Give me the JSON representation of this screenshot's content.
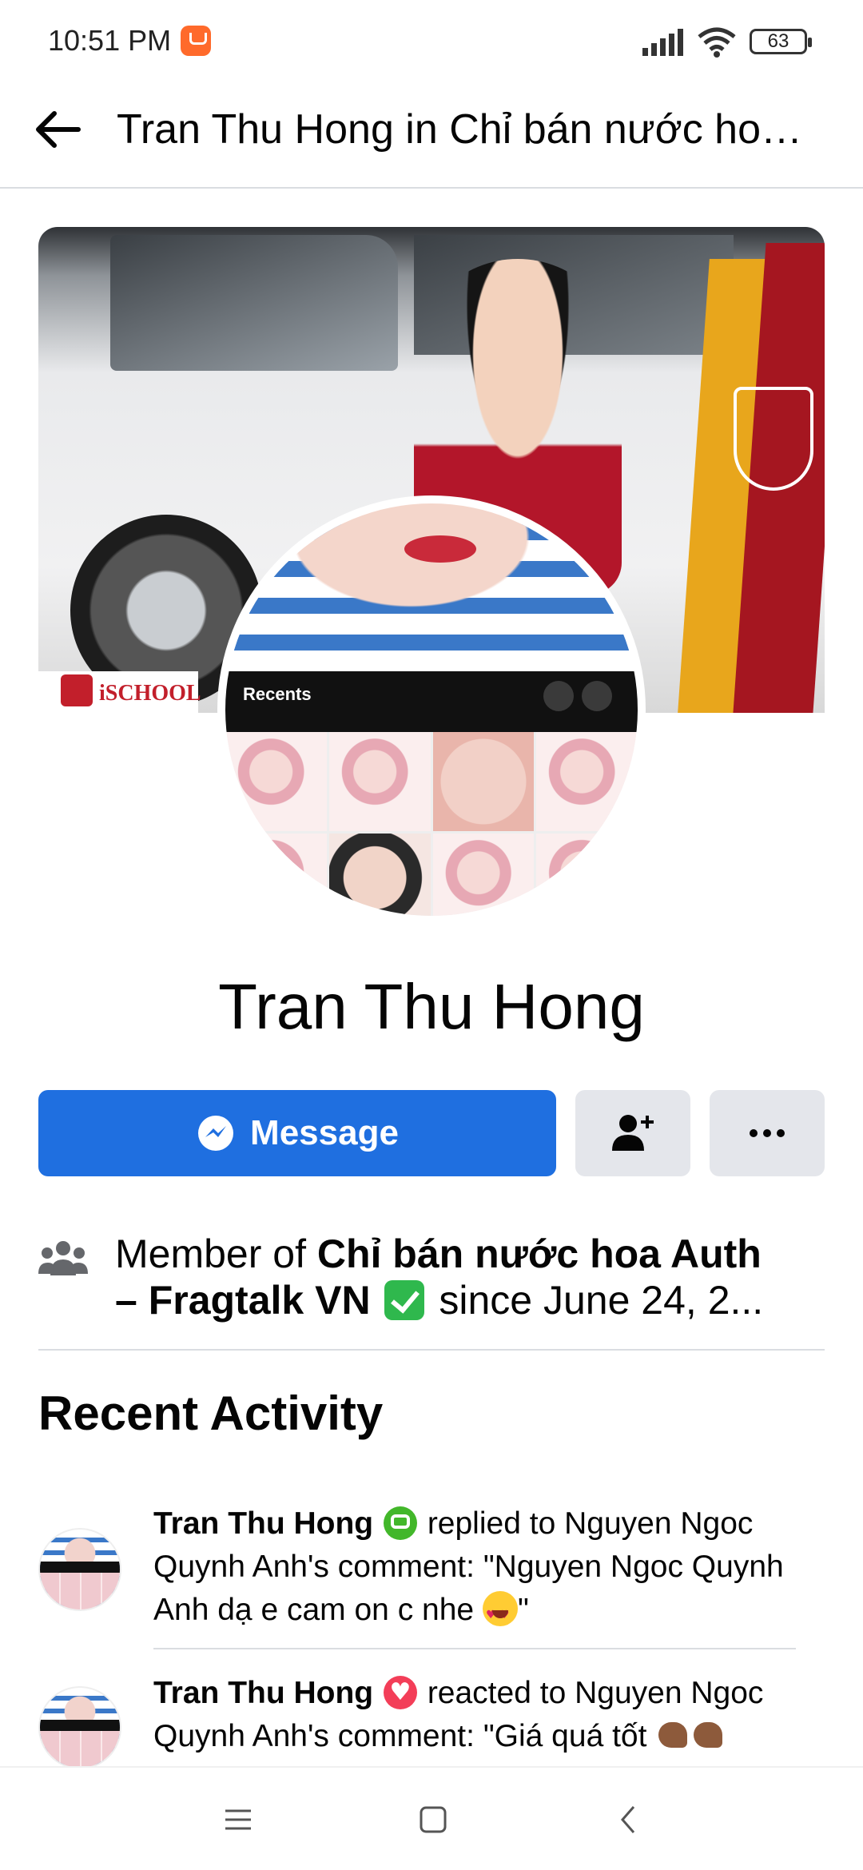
{
  "status_bar": {
    "time": "10:51 PM",
    "battery": "63"
  },
  "header": {
    "title": "Tran Thu Hong in Chỉ bán nước hoa Auth - Fragtalk VN ✅"
  },
  "cover": {
    "logo_text": "iSCHOOL"
  },
  "avatar": {
    "recents_label": "Recents"
  },
  "profile": {
    "name": "Tran Thu Hong"
  },
  "actions": {
    "message_label": "Message"
  },
  "membership": {
    "prefix": "Member of ",
    "group_name_line1": "Chỉ bán nước hoa Auth",
    "group_name_line2": "– Fragtalk VN",
    "suffix": " since June 24, 2..."
  },
  "recent_activity": {
    "title": "Recent Activity",
    "items": [
      {
        "actor": "Tran Thu Hong",
        "action": " replied to Nguyen Ngoc Quynh Anh's comment: \"Nguyen Ngoc Quynh Anh dạ e cam on c nhe ",
        "end": "\""
      },
      {
        "actor": "Tran Thu Hong",
        "action": " reacted to Nguyen Ngoc Quynh Anh's comment: \"Giá quá tốt "
      }
    ]
  },
  "colors": {
    "primary": "#1f6fe0",
    "secondary_button": "#e4e6eb",
    "divider": "#dadde1",
    "text": "#050505"
  },
  "icons": {
    "back": "arrow-left-icon",
    "messenger": "messenger-icon",
    "add_friend": "add-friend-icon",
    "more": "more-dots-icon",
    "members": "members-icon",
    "comment": "comment-icon",
    "love": "love-reaction-icon"
  }
}
